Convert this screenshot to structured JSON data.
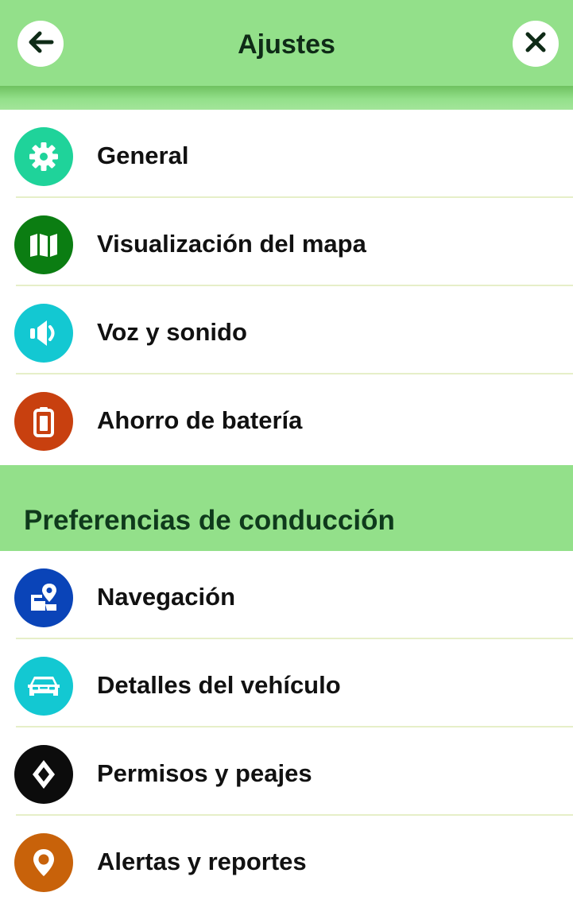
{
  "header": {
    "title": "Ajustes",
    "back_icon": "arrow-left-icon",
    "close_icon": "close-icon",
    "background": "#93e08a"
  },
  "general_items": [
    {
      "label": "General",
      "icon": "gear-icon",
      "color": "#1fd39a"
    },
    {
      "label": "Visualización del mapa",
      "icon": "map-icon",
      "color": "#0b7d12"
    },
    {
      "label": "Voz y sonido",
      "icon": "speaker-icon",
      "color": "#13c8d2"
    },
    {
      "label": "Ahorro de batería",
      "icon": "battery-icon",
      "color": "#c8400f"
    }
  ],
  "driving_section": {
    "title": "Preferencias de conducción",
    "items": [
      {
        "label": "Navegación",
        "icon": "navigation-map-icon",
        "color": "#0a44b8"
      },
      {
        "label": "Detalles del vehículo",
        "icon": "car-icon",
        "color": "#13c8d2"
      },
      {
        "label": "Permisos y peajes",
        "icon": "diamond-sign-icon",
        "color": "#0c0c0c"
      },
      {
        "label": "Alertas y reportes",
        "icon": "location-pin-icon",
        "color": "#c8620a"
      }
    ]
  }
}
